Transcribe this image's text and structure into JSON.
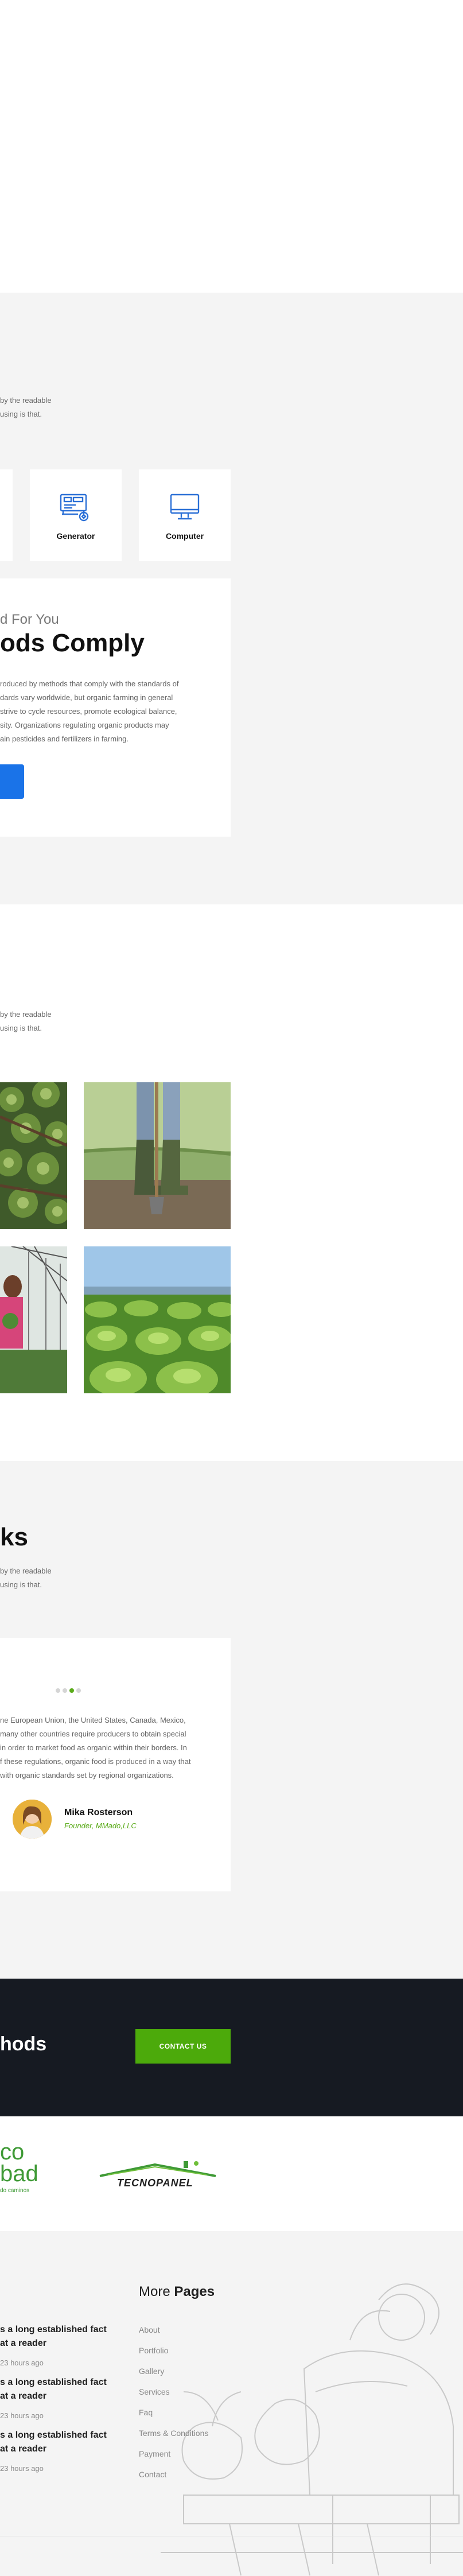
{
  "features": {
    "intro_line1": "by the readable",
    "intro_line2": "using is that.",
    "icons": [
      {
        "label": "Generator",
        "icon": "generator-icon"
      },
      {
        "label": "Computer",
        "icon": "computer-icon"
      }
    ],
    "kicker": "d For You",
    "heading": "ods Comply",
    "body": [
      "roduced by methods that comply with the standards of",
      "dards vary worldwide, but organic farming in general",
      "strive to cycle resources, promote ecological balance,",
      "sity. Organizations regulating organic products may",
      "ain pesticides and fertilizers in farming."
    ],
    "accent": "#1a73e8"
  },
  "gallery": {
    "intro_line1": "by the readable",
    "intro_line2": "using is that.",
    "photos": [
      "cabbage-field-photo",
      "farmer-boots-photo",
      "greenhouse-woman-photo",
      "lettuce-field-photo"
    ]
  },
  "testimonials": {
    "heading": "ks",
    "intro_line1": "by the readable",
    "intro_line2": "using is that.",
    "quote": [
      "ne European Union, the United States, Canada, Mexico,",
      "many other countries require producers to obtain special",
      "in order to market food as organic within their borders. In",
      "f these regulations, organic food is produced in a way that",
      "with organic standards set by regional organizations."
    ],
    "author_name": "Mika Rosterson",
    "author_role": "Founder, MMado,LLC",
    "active_dot": 2,
    "dot_count": 4,
    "accent": "#5aab1a"
  },
  "cta": {
    "heading": "hods",
    "button_label": "CONTACT US",
    "button_color": "#4caa0b"
  },
  "partners": {
    "logo1_line1": "co",
    "logo1_line2": "bad",
    "logo1_tag": "do caminos",
    "logo2_text": "TECNOPANEL"
  },
  "footer": {
    "posts": [
      {
        "line1": "s a long established fact",
        "line2": "at a reader",
        "time": "23 hours ago"
      },
      {
        "line1": "s a long established fact",
        "line2": "at a reader",
        "time": "23 hours ago"
      },
      {
        "line1": "s a long established fact",
        "line2": "at a reader",
        "time": "23 hours ago"
      }
    ],
    "more_title_light": "More",
    "more_title_bold": "Pages",
    "links": [
      "About",
      "Portfolio",
      "Gallery",
      "Services",
      "Faq",
      "Terms & Conditions",
      "Payment",
      "Contact"
    ]
  }
}
